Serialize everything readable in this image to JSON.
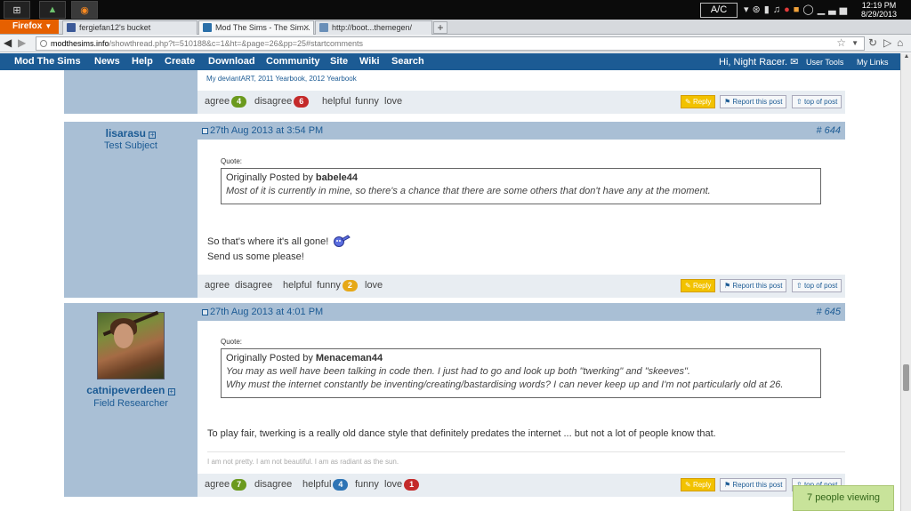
{
  "taskbar": {
    "ac_label": "A/C",
    "clock_time": "12:19 PM",
    "clock_date": "8/29/2013"
  },
  "browser": {
    "menu_label": "Firefox",
    "tabs": [
      {
        "title": "fergiefan12's bucket",
        "favicon_color": "#3b5998",
        "active": false
      },
      {
        "title": "Mod The Sims - The Sim...",
        "favicon_color": "#2a6fa8",
        "active": true
      },
      {
        "title": "http://boot...themegen/",
        "favicon_color": "#6a8fb8",
        "active": false
      }
    ],
    "url_host": "modthesims.info",
    "url_path": "/showthread.php?t=510188&c=1&ht=&page=26&pp=25#startcomments"
  },
  "site_nav": {
    "brand": "Mod The Sims",
    "items": [
      "News",
      "Help",
      "Create",
      "Download",
      "Community",
      "Site",
      "Wiki",
      "Search"
    ],
    "greeting": "Hi, Night Racer.",
    "user_tools": "User Tools",
    "my_links": "My Links"
  },
  "prev_post": {
    "signature_links": "My deviantART, 2011 Yearbook, 2012 Yearbook",
    "ratings": {
      "agree": "agree",
      "agree_count": "4",
      "disagree": "disagree",
      "disagree_count": "6",
      "helpful": "helpful",
      "funny": "funny",
      "love": "love"
    }
  },
  "actions": {
    "reply": "Reply",
    "report": "Report this post",
    "top": "top of post"
  },
  "post1": {
    "username": "lisarasu",
    "rank": "Test Subject",
    "date": "27th Aug 2013 at 3:54 PM",
    "number": "644",
    "quote_label": "Quote:",
    "quote_by_prefix": "Originally Posted by",
    "quote_author": "babele44",
    "quote_text": "Most of it is currently in mine, so there's a chance that there are some others that don't have any at the moment.",
    "text_line1": "So that's where it's all gone!",
    "text_line2": "Send us some please!",
    "ratings": {
      "agree": "agree",
      "disagree": "disagree",
      "helpful": "helpful",
      "funny": "funny",
      "funny_count": "2",
      "love": "love"
    }
  },
  "post2": {
    "username": "catnipeverdeen",
    "rank": "Field Researcher",
    "date": "27th Aug 2013 at 4:01 PM",
    "number": "645",
    "quote_label": "Quote:",
    "quote_by_prefix": "Originally Posted by",
    "quote_author": "Menaceman44",
    "quote_line1": "You may as well have been talking in code then. I just had to go and look up both \"twerking\" and \"skeeves\".",
    "quote_line2": "Why must the internet constantly be inventing/creating/bastardising words? I can never keep up and I'm not particularly old at 26.",
    "text": "To play fair, twerking is a really old dance style that definitely predates the internet ... but not a lot of people know that.",
    "signature": "I am not pretty. I am not beautiful. I am as radiant as the sun.",
    "ratings": {
      "agree": "agree",
      "agree_count": "7",
      "disagree": "disagree",
      "helpful": "helpful",
      "helpful_count": "4",
      "funny": "funny",
      "love": "love",
      "love_count": "1"
    }
  },
  "viewing": "7 people viewing"
}
